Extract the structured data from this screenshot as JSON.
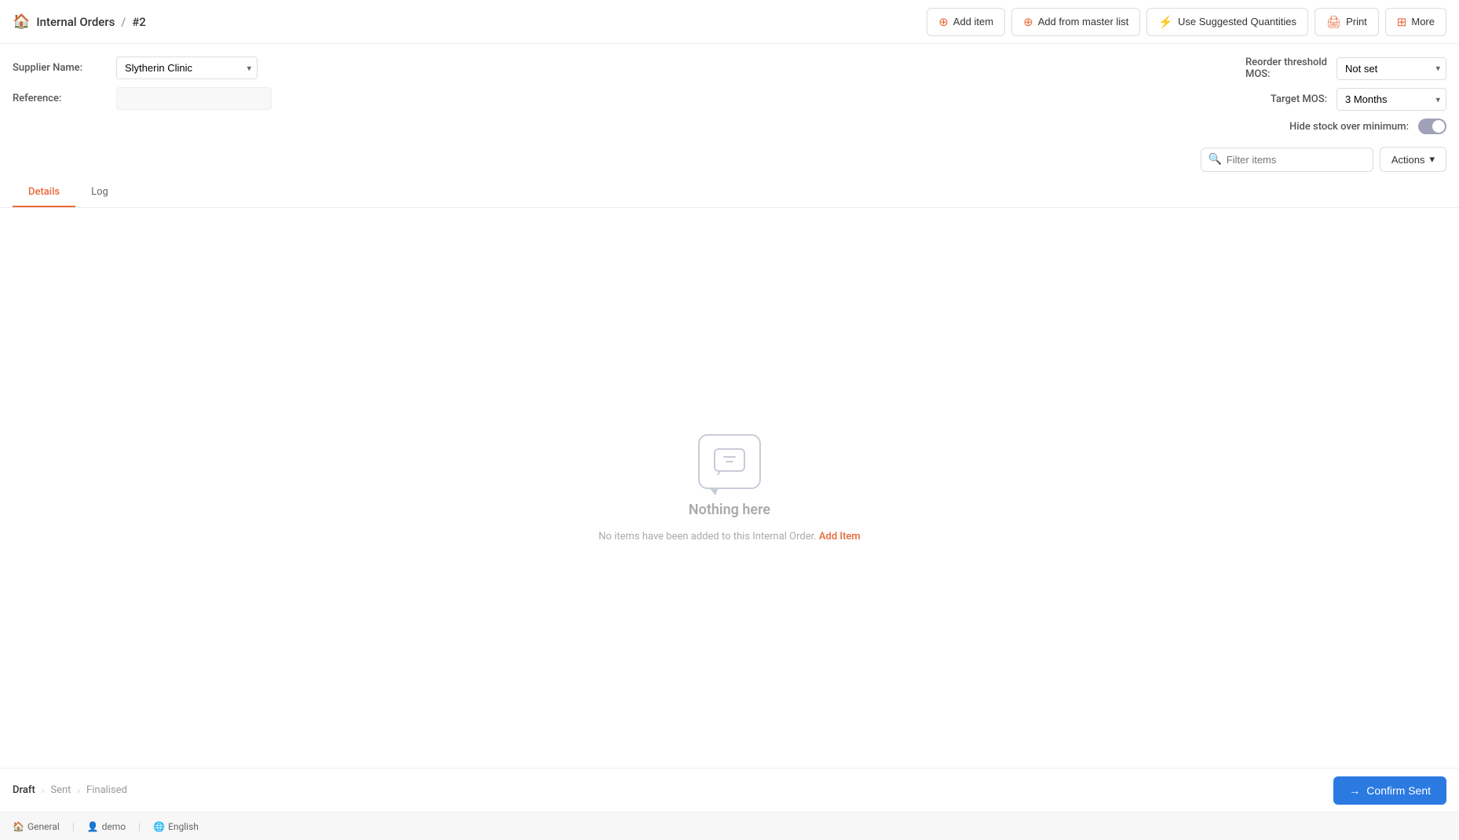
{
  "header": {
    "icon": "🏠",
    "breadcrumb_parent": "Internal Orders",
    "separator": "/",
    "breadcrumb_current": "#2",
    "buttons": [
      {
        "id": "add-item",
        "icon": "⊕",
        "label": "Add item"
      },
      {
        "id": "add-from-master",
        "icon": "⊕",
        "label": "Add from master list"
      },
      {
        "id": "use-suggested",
        "icon": "⚡",
        "label": "Use Suggested Quantities"
      },
      {
        "id": "print",
        "icon": "🖨",
        "label": "Print"
      },
      {
        "id": "more",
        "icon": "⊞",
        "label": "More"
      }
    ]
  },
  "form": {
    "supplier_label": "Supplier Name:",
    "supplier_value": "Slytherin Clinic",
    "reference_label": "Reference:",
    "reference_value": ""
  },
  "right_panel": {
    "reorder_label": "Reorder threshold\nMOS:",
    "reorder_value": "Not set",
    "target_mos_label": "Target MOS:",
    "target_mos_value": "3 Months",
    "hide_stock_label": "Hide stock over minimum:",
    "toggle_state": false
  },
  "filter_bar": {
    "placeholder": "Filter items",
    "actions_label": "Actions",
    "chevron": "▾"
  },
  "tabs": [
    {
      "id": "details",
      "label": "Details",
      "active": true
    },
    {
      "id": "log",
      "label": "Log",
      "active": false
    }
  ],
  "empty_state": {
    "title": "Nothing here",
    "description": "No items have been added to this Internal Order.",
    "link_text": "Add Item"
  },
  "footer": {
    "status_items": [
      {
        "id": "draft",
        "label": "Draft",
        "active": true
      },
      {
        "id": "sent",
        "label": "Sent",
        "active": false
      },
      {
        "id": "finalised",
        "label": "Finalised",
        "active": false
      }
    ],
    "confirm_btn_label": "Confirm Sent"
  },
  "bottom_bar": {
    "general_label": "General",
    "user_label": "demo",
    "language_label": "English"
  },
  "colors": {
    "accent": "#e8693a",
    "blue": "#2a7ae2"
  }
}
